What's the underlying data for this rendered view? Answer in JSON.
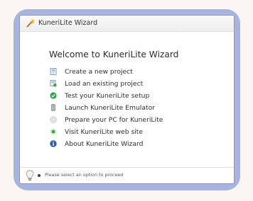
{
  "window": {
    "title": "KuneriLite Wizard",
    "heading": "Welcome to KuneriLite Wizard"
  },
  "menu": {
    "items": [
      {
        "label": "Create a new project",
        "icon": "new-project-icon"
      },
      {
        "label": "Load an existing project",
        "icon": "load-project-icon"
      },
      {
        "label": "Test your KuneriLite setup",
        "icon": "test-check-icon"
      },
      {
        "label": "Launch KuneriLite Emulator",
        "icon": "emulator-icon"
      },
      {
        "label": "Prepare your PC for KuneriLite",
        "icon": "prepare-pc-icon"
      },
      {
        "label": "Visit KuneriLite web site",
        "icon": "web-site-icon"
      },
      {
        "label": "About KuneriLite Wizard",
        "icon": "info-icon"
      }
    ]
  },
  "status": {
    "text": "Please select an option to proceed",
    "icon": "lightbulb-icon"
  },
  "colors": {
    "frame": "#a8b4e0",
    "accent_blue": "#2f5fa8",
    "check_green": "#36a34a"
  }
}
